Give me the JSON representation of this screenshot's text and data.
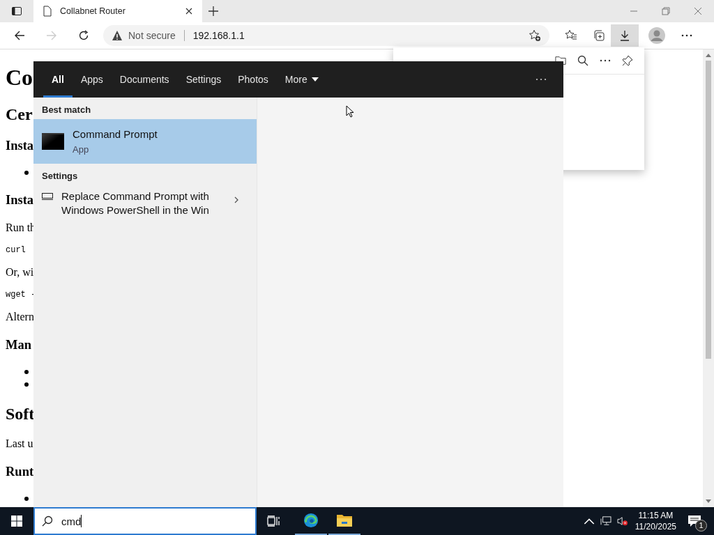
{
  "browser": {
    "tab_title": "Collabnet Router",
    "security": "Not secure",
    "url": "192.168.1.1"
  },
  "page": {
    "lines": [
      {
        "kind": "h1",
        "text": "Co"
      },
      {
        "kind": "h2",
        "text": "Cer"
      },
      {
        "kind": "h3",
        "text": "Insta"
      },
      {
        "kind": "bullet"
      },
      {
        "kind": "h3",
        "text": "Insta"
      },
      {
        "kind": "p",
        "text": "Run th"
      },
      {
        "kind": "code",
        "text": "curl"
      },
      {
        "kind": "p",
        "text": "Or, wi"
      },
      {
        "kind": "code",
        "text": "wget -"
      },
      {
        "kind": "p",
        "text": "Altern"
      },
      {
        "kind": "h3",
        "text": "Man"
      },
      {
        "kind": "bullet"
      },
      {
        "kind": "bullet"
      },
      {
        "kind": "h2",
        "text": "Soft"
      },
      {
        "kind": "p",
        "text": "Last u"
      },
      {
        "kind": "h3",
        "text": "Runt"
      },
      {
        "kind": "bullet"
      }
    ]
  },
  "search": {
    "tabs": [
      {
        "label": "All",
        "selected": true,
        "dropdown": false
      },
      {
        "label": "Apps",
        "selected": false,
        "dropdown": false
      },
      {
        "label": "Documents",
        "selected": false,
        "dropdown": false
      },
      {
        "label": "Settings",
        "selected": false,
        "dropdown": false
      },
      {
        "label": "Photos",
        "selected": false,
        "dropdown": false
      },
      {
        "label": "More",
        "selected": false,
        "dropdown": true
      }
    ],
    "sections": [
      {
        "title": "Best match",
        "results": [
          {
            "kind": "app",
            "title": "Command Prompt",
            "subtitle": "App",
            "selected": true
          }
        ]
      },
      {
        "title": "Settings",
        "results": [
          {
            "kind": "setting",
            "title": "Replace Command Prompt with Windows PowerShell in the Win",
            "selected": false
          }
        ]
      }
    ],
    "query": "cmd"
  },
  "taskbar": {
    "time": "11:15 AM",
    "date": "11/20/2025",
    "notifications": "1"
  }
}
